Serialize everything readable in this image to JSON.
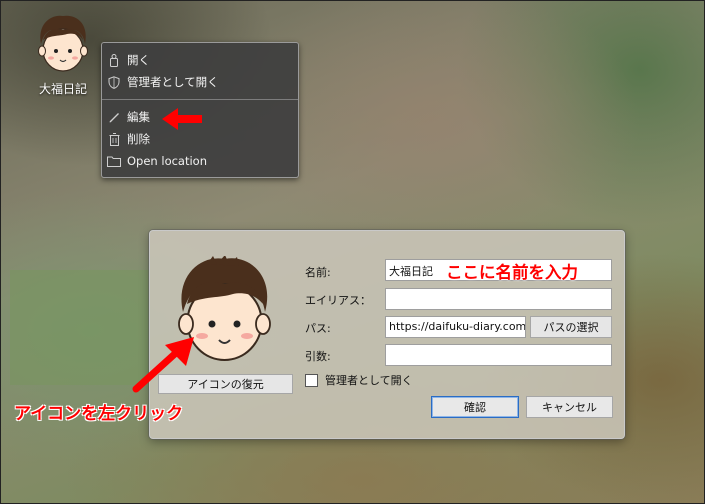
{
  "desktop": {
    "icon_label": "大福日記"
  },
  "context_menu": {
    "items": [
      {
        "label": "開く",
        "icon": "lock-icon"
      },
      {
        "label": "管理者として開く",
        "icon": "shield-icon"
      },
      {
        "label": "編集",
        "icon": "pencil-icon"
      },
      {
        "label": "削除",
        "icon": "trash-icon"
      },
      {
        "label": "Open location",
        "icon": "folder-icon"
      }
    ]
  },
  "dialog": {
    "restore_button": "アイコンの復元",
    "name_label": "名前:",
    "name_value": "大福日記",
    "alias_label": "エイリアス：",
    "alias_value": "",
    "path_label": "パス:",
    "path_value": "https://daifuku-diary.com/",
    "browse_button": "パスの選択",
    "args_label": "引数:",
    "args_value": "",
    "admin_checkbox_label": "管理者として開く",
    "admin_checked": false,
    "ok_button": "確認",
    "cancel_button": "キャンセル"
  },
  "annotations": {
    "name_hint": "ここに名前を入力",
    "icon_hint": "アイコンを左クリック"
  },
  "colors": {
    "annotation": "#ff0000",
    "menu_bg": "#3e3e3e",
    "accent_border": "#2b6cc4"
  }
}
